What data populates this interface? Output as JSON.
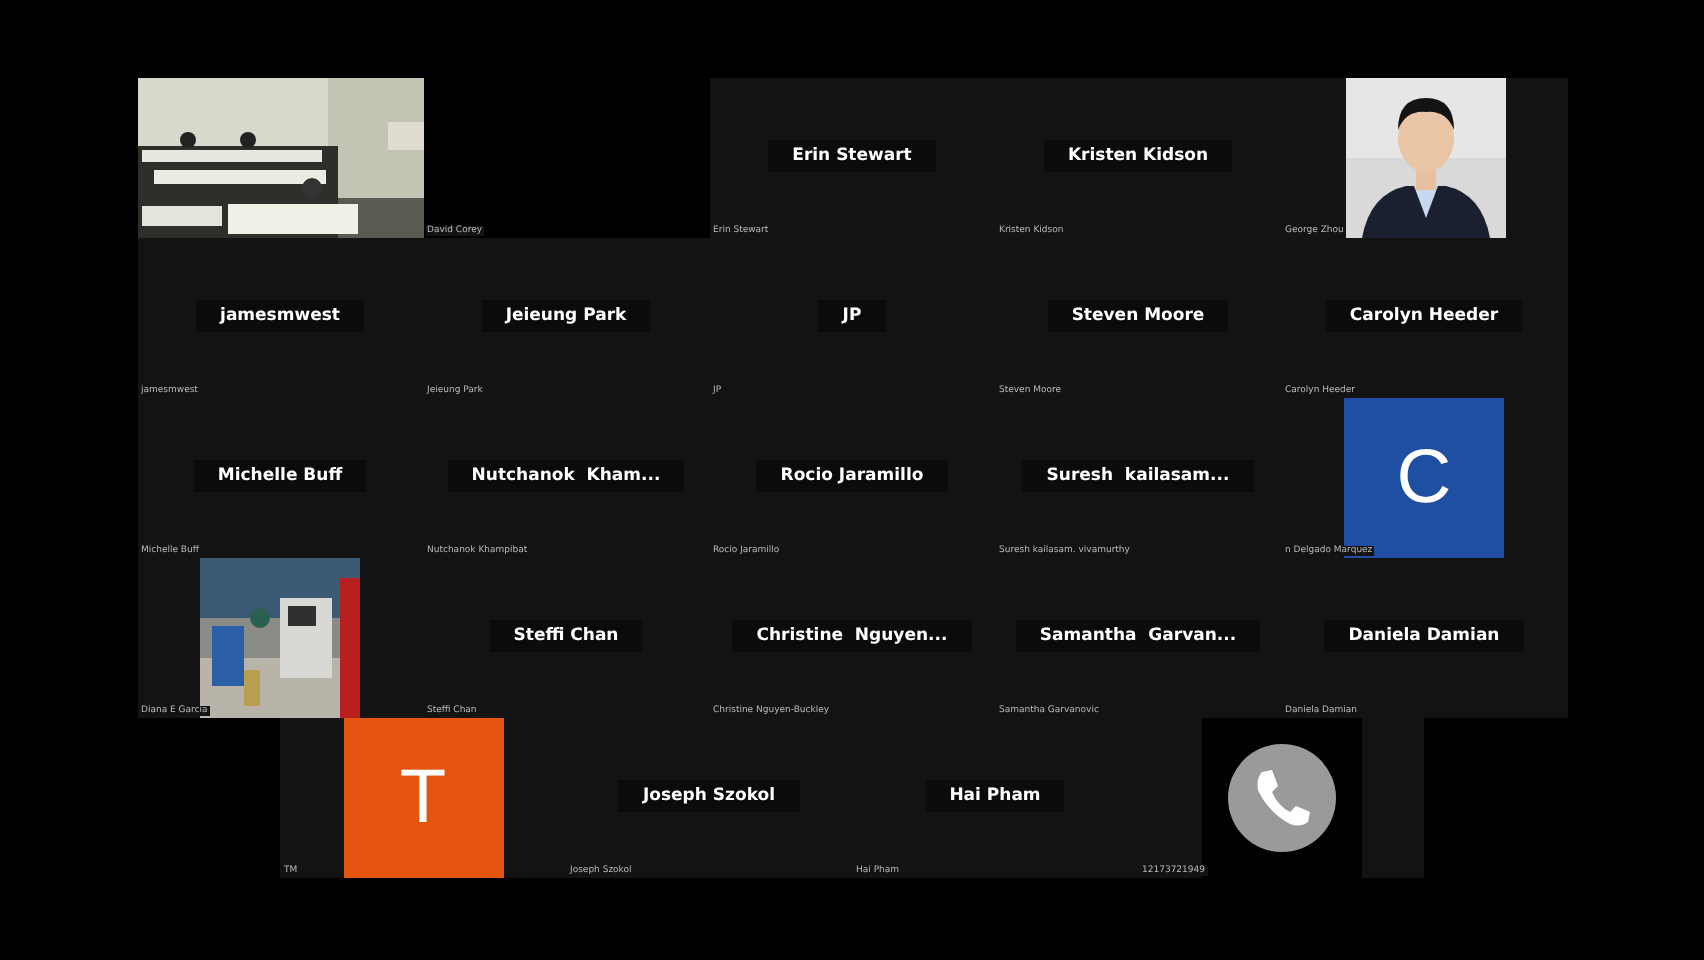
{
  "rows": [
    [
      {
        "kind": "video"
      },
      {
        "kind": "blank",
        "label": "David Corey"
      },
      {
        "kind": "plate",
        "name": "Erin Stewart",
        "label": "Erin Stewart"
      },
      {
        "kind": "plate",
        "name": "Kristen Kidson",
        "label": "Kristen Kidson"
      },
      {
        "label": "George Zhou"
      }
    ],
    [
      {
        "kind": "plate",
        "name": "jamesmwest",
        "label": "jamesmwest"
      },
      {
        "kind": "plate",
        "name": "Jeieung Park",
        "label": "Jeieung Park"
      },
      {
        "kind": "plate",
        "name": "JP",
        "label": "JP"
      },
      {
        "kind": "plate",
        "name": "Steven Moore",
        "label": "Steven Moore"
      },
      {
        "kind": "plate",
        "name": "Carolyn Heeder",
        "label": "Carolyn Heeder"
      }
    ],
    [
      {
        "kind": "plate",
        "name": "Michelle Buff",
        "label": "Michelle Buff"
      },
      {
        "kind": "plate",
        "name": "Nutchanok  Kham...",
        "label": "Nutchanok Khampibat"
      },
      {
        "kind": "plate",
        "name": "Rocio Jaramillo",
        "label": "Rocio Jaramillo"
      },
      {
        "kind": "plate",
        "name": "Suresh  kailasam...",
        "label": "Suresh kailasam. vivamurthy"
      },
      {
        "kind": "avatar",
        "letter": "C",
        "color": "#1e4fa3",
        "label": "n Delgado Marquez"
      }
    ],
    [
      {
        "kind": "video-small",
        "label": "Diana E Garcia"
      },
      {
        "kind": "plate",
        "name": "Steffi Chan",
        "label": "Steffi Chan"
      },
      {
        "kind": "plate",
        "name": "Christine  Nguyen...",
        "label": "Christine Nguyen-Buckley"
      },
      {
        "kind": "plate",
        "name": "Samantha  Garvan...",
        "label": "Samantha Garvanovic"
      },
      {
        "kind": "plate",
        "name": "Daniela Damian",
        "label": "Daniela Damian"
      }
    ],
    [
      {
        "kind": "avatar",
        "letter": "T",
        "color": "#e6550f",
        "label": "TM"
      },
      {
        "kind": "plate",
        "name": "Joseph Szokol",
        "label": "Joseph Szokol"
      },
      {
        "kind": "plate",
        "name": "Hai Pham",
        "label": "Hai Pham"
      },
      {
        "kind": "phone",
        "label": "12173721949"
      }
    ]
  ]
}
